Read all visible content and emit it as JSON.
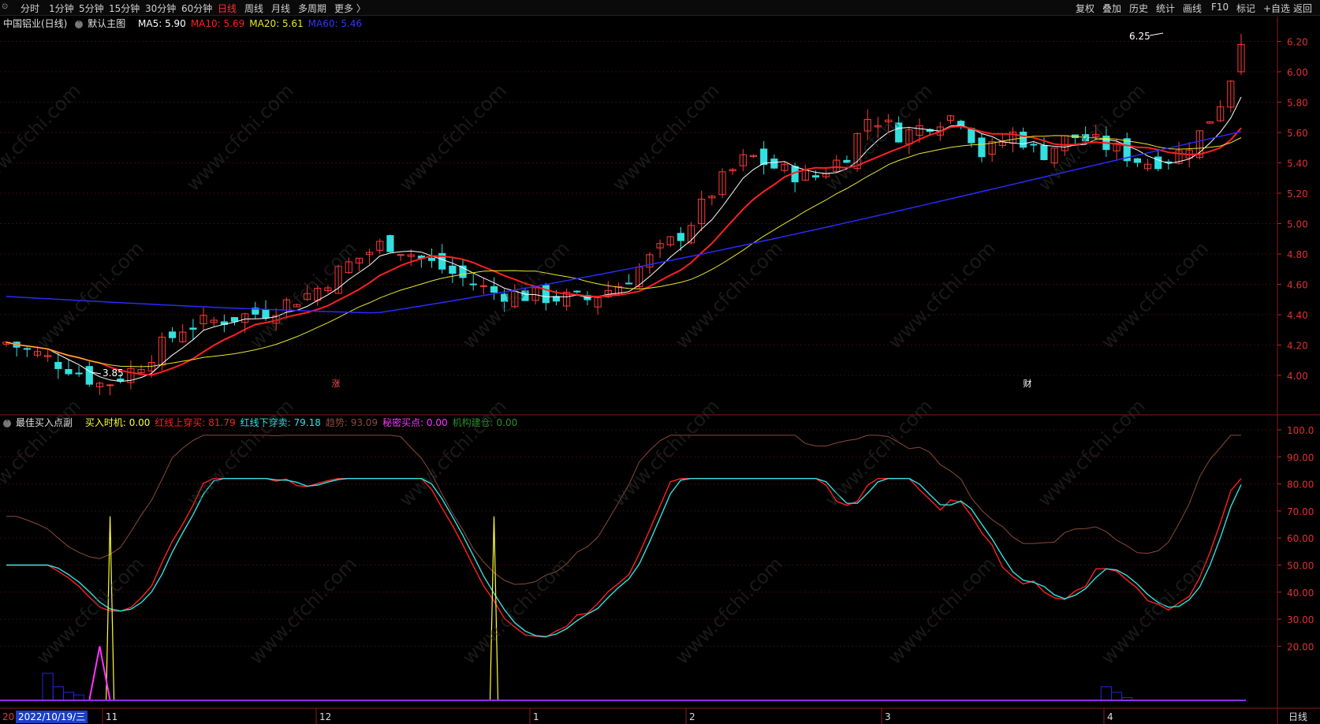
{
  "toolbar": {
    "left_tabs": [
      "分时",
      "1分钟",
      "5分钟",
      "15分钟",
      "30分钟",
      "60分钟",
      "日线",
      "周线",
      "月线",
      "多周期",
      "更多 〉"
    ],
    "active_tab": "日线",
    "right_tabs": [
      "复权",
      "叠加",
      "历史",
      "统计",
      "画线",
      "F10",
      "标记",
      "+自选",
      "返回"
    ]
  },
  "main_chart": {
    "stock_name": "中国铝业(日线)",
    "template": "默认主图",
    "ma": [
      {
        "label": "MA5: 5.90",
        "color": "#ffffff"
      },
      {
        "label": "MA10: 5.69",
        "color": "#ff2020"
      },
      {
        "label": "MA20: 5.61",
        "color": "#e6e632"
      },
      {
        "label": "MA60: 5.46",
        "color": "#3333ff"
      }
    ],
    "price_axis": [
      "6.20",
      "6.00",
      "5.80",
      "5.60",
      "5.40",
      "5.20",
      "5.00",
      "4.80",
      "4.60",
      "4.40",
      "4.20",
      "4.00"
    ],
    "high_marker": "6.25",
    "low_marker": "3.85",
    "event_labels": [
      "涨",
      "财"
    ],
    "candle_colors": {
      "up": "#ff3b3b",
      "down": "#33e0e0"
    }
  },
  "indicator": {
    "name": "最佳买入点副",
    "fields": [
      {
        "label": "买入时机: 0.00",
        "color": "#ffff33"
      },
      {
        "label": "红线上穿买: 81.79",
        "color": "#ff2020"
      },
      {
        "label": "红线下穿卖: 79.18",
        "color": "#33e0e0"
      },
      {
        "label": "趋势: 93.09",
        "color": "#8a4a3a"
      },
      {
        "label": "秘密买点: 0.00",
        "color": "#ff33ff"
      },
      {
        "label": "机构建仓: 0.00",
        "color": "#2e8b2e"
      }
    ],
    "axis": [
      "100.0",
      "90.00",
      "80.00",
      "70.00",
      "60.00",
      "50.00",
      "40.00",
      "30.00",
      "20.00"
    ]
  },
  "time_axis": {
    "start_label": "20",
    "cursor_date": "2022/10/19/三",
    "months": [
      "11",
      "12",
      "1",
      "2",
      "3",
      "4"
    ],
    "period": "日线"
  },
  "watermark": "www.cfchi.com"
}
